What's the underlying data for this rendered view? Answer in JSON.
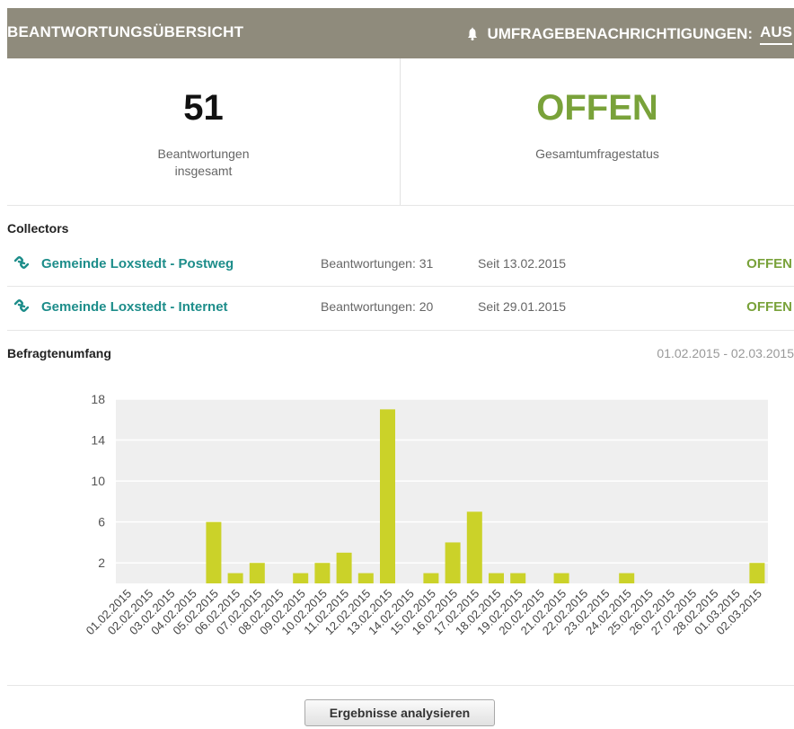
{
  "header": {
    "title": "BEANTWORTUNGSÜBERSICHT",
    "notifications_label": "UMFRAGEBENACHRICHTIGUNGEN:",
    "notifications_value": "AUS",
    "bell_icon": "bell-icon"
  },
  "stats": {
    "total_responses": "51",
    "total_responses_label_line1": "Beantwortungen",
    "total_responses_label_line2": "insgesamt",
    "status": "OFFEN",
    "status_label": "Gesamtumfragestatus",
    "status_color": "#79a23a"
  },
  "collectors": {
    "title": "Collectors",
    "link_icon": "link-icon",
    "items": [
      {
        "name": "Gemeinde Loxstedt - Postweg",
        "responses": "Beantwortungen: 31",
        "since": "Seit 13.02.2015",
        "status": "OFFEN"
      },
      {
        "name": "Gemeinde Loxstedt - Internet",
        "responses": "Beantwortungen: 20",
        "since": "Seit 29.01.2015",
        "status": "OFFEN"
      }
    ]
  },
  "volume": {
    "title": "Befragtenumfang",
    "range": "01.02.2015 - 02.03.2015"
  },
  "chart_data": {
    "type": "bar",
    "title": "",
    "xlabel": "",
    "ylabel": "",
    "ylim": [
      0,
      18
    ],
    "yticks": [
      2,
      6,
      10,
      14,
      18
    ],
    "bar_color": "#cbd229",
    "grid": true,
    "categories": [
      "01.02.2015",
      "02.02.2015",
      "03.02.2015",
      "04.02.2015",
      "05.02.2015",
      "06.02.2015",
      "07.02.2015",
      "08.02.2015",
      "09.02.2015",
      "10.02.2015",
      "11.02.2015",
      "12.02.2015",
      "13.02.2015",
      "14.02.2015",
      "15.02.2015",
      "16.02.2015",
      "17.02.2015",
      "18.02.2015",
      "19.02.2015",
      "20.02.2015",
      "21.02.2015",
      "22.02.2015",
      "23.02.2015",
      "24.02.2015",
      "25.02.2015",
      "26.02.2015",
      "27.02.2015",
      "28.02.2015",
      "01.03.2015",
      "02.03.2015"
    ],
    "values": [
      0,
      0,
      0,
      0,
      6,
      1,
      2,
      0,
      1,
      2,
      3,
      1,
      17,
      0,
      1,
      4,
      7,
      1,
      1,
      0,
      1,
      0,
      0,
      1,
      0,
      0,
      0,
      0,
      0,
      2
    ]
  },
  "actions": {
    "analyze_label": "Ergebnisse analysieren"
  }
}
